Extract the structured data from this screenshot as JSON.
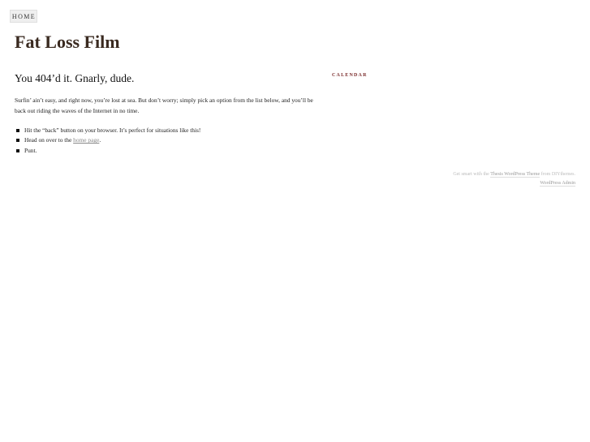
{
  "nav": {
    "home_label": "HOME"
  },
  "site": {
    "title": "Fat Loss Film"
  },
  "error_page": {
    "headline": "You 404’d it. Gnarly, dude.",
    "intro": "Surfin’ ain’t easy, and right now, you’re lost at sea. But don’t worry; simply pick an option from the list below, and you’ll be back out riding the waves of the Internet in no time.",
    "options": {
      "back": "Hit the “back” button on your browser. It’s perfect for situations like this!",
      "home_prefix": "Head on over to the ",
      "home_link": "home page",
      "home_suffix": ".",
      "punt": "Punt."
    }
  },
  "sidebar": {
    "calendar_heading": "CALENDAR"
  },
  "footer": {
    "prefix": "Get smart with the ",
    "thesis_link": "Thesis WordPress Theme",
    "middle": " from DIYthemes.",
    "admin_link": "WordPress Admin"
  },
  "colors": {
    "title": "#3a2a20",
    "calendar_heading": "#7a2a2a",
    "nav_background": "#efefef"
  }
}
